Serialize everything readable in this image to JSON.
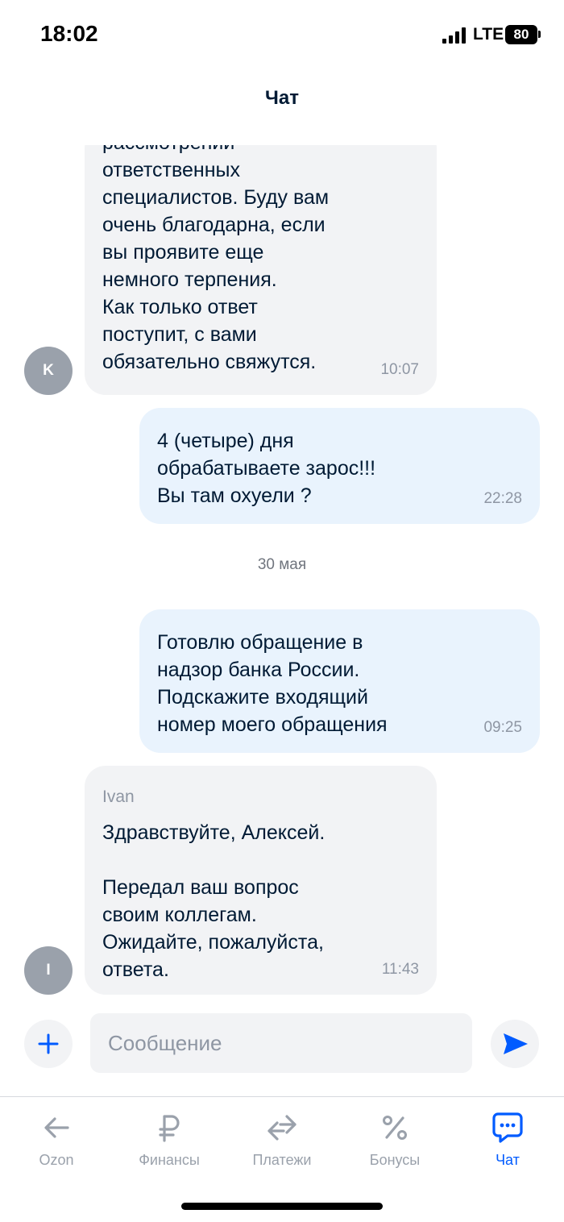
{
  "status_bar": {
    "time": "18:02",
    "network": "LTE",
    "battery": "80"
  },
  "header": {
    "title": "Чат"
  },
  "messages": [
    {
      "direction": "in",
      "avatar_letter": "K",
      "sender": "",
      "text": "рассмотрении\nответственных\nспециалистов. Буду вам\nочень благодарна, если\nвы проявите еще\nнемного терпения.\nКак только ответ\nпоступит, с вами\nобязательно свяжутся.",
      "time": "10:07"
    },
    {
      "direction": "out",
      "text": "4 (четыре) дня\nобрабатываете зарос!!!\nВы там охуели ?",
      "time": "22:28"
    },
    {
      "direction": "date",
      "text": "30 мая"
    },
    {
      "direction": "out",
      "text": "Готовлю обращение в\nнадзор банка России.\nПодскажите входящий\nномер моего обращения",
      "time": "09:25"
    },
    {
      "direction": "in",
      "avatar_letter": "I",
      "sender": "Ivan",
      "text": "Здравствуйте, Алексей.\n\nПередал ваш вопрос\nсвоим коллегам.\nОжидайте, пожалуйста,\nответа.",
      "time": "11:43"
    }
  ],
  "composer": {
    "placeholder": "Сообщение"
  },
  "nav": {
    "items": [
      {
        "label": "Ozon",
        "icon": "arrow-left-icon",
        "active": false
      },
      {
        "label": "Финансы",
        "icon": "ruble-icon",
        "active": false
      },
      {
        "label": "Платежи",
        "icon": "transfer-arrows-icon",
        "active": false
      },
      {
        "label": "Бонусы",
        "icon": "percent-icon",
        "active": false
      },
      {
        "label": "Чат",
        "icon": "chat-bubble-icon",
        "active": true
      }
    ]
  },
  "colors": {
    "accent": "#005bff",
    "incoming_bubble": "#f2f3f5",
    "outgoing_bubble": "#e9f3fd",
    "avatar": "#9aa1ab"
  }
}
